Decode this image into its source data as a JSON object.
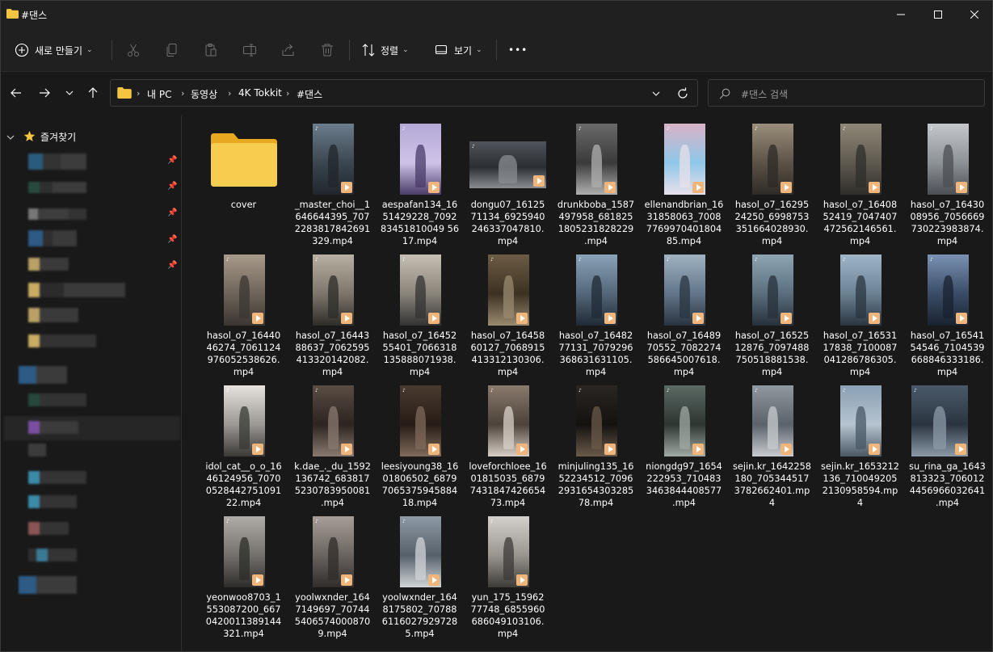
{
  "window": {
    "title": "#댄스"
  },
  "toolbar": {
    "new_label": "새로 만들기",
    "sort_label": "정렬",
    "view_label": "보기",
    "more_label": "•••"
  },
  "address": {
    "crumbs": [
      "내 PC",
      "동영상",
      "4K Tokkit",
      "#댄스"
    ]
  },
  "search": {
    "placeholder": "#댄스 검색"
  },
  "sidebar": {
    "favorites_label": "즐겨찾기"
  },
  "files": [
    {
      "name": "cover",
      "type": "folder"
    },
    {
      "name": "_master_choi__1\n646644395_707\n2283817842691\n329.mp4",
      "type": "video"
    },
    {
      "name": "aespafan134_16\n51429228_7092\n83451810049 56\n17.mp4",
      "type": "video"
    },
    {
      "name": "dongu07_16125\n71134_6925940\n246337047810.\nmp4",
      "type": "video"
    },
    {
      "name": "drunkboba_1587\n497958_681825\n1805231828229\n.mp4",
      "type": "video"
    },
    {
      "name": "ellenandbrian_16\n31858063_7008\n7769970401804\n85.mp4",
      "type": "video"
    },
    {
      "name": "hasol_o7_16295\n24250_6998753\n351664028930.\nmp4",
      "type": "video"
    },
    {
      "name": "hasol_o7_16408\n52419_7047407\n472562146561.\nmp4",
      "type": "video"
    },
    {
      "name": "hasol_o7_16430\n08956_7056669\n730223983874.\nmp4",
      "type": "video"
    },
    {
      "name": "hasol_o7_16440\n46274_7061124\n976052538626.\nmp4",
      "type": "video"
    },
    {
      "name": "hasol_o7_16443\n88637_7062595\n413320142082.\nmp4",
      "type": "video"
    },
    {
      "name": "hasol_o7_16452\n55401_7066318\n135888071938.\nmp4",
      "type": "video"
    },
    {
      "name": "hasol_o7_16458\n60127_7068915\n413312130306.\nmp4",
      "type": "video"
    },
    {
      "name": "hasol_o7_16482\n77131_7079296\n368631631105.\nmp4",
      "type": "video"
    },
    {
      "name": "hasol_o7_16489\n70552_7082274\n586645007618.\nmp4",
      "type": "video"
    },
    {
      "name": "hasol_o7_16525\n12876_7097488\n750518881538.\nmp4",
      "type": "video"
    },
    {
      "name": "hasol_o7_16531\n17838_7100087\n041286786305.\nmp4",
      "type": "video"
    },
    {
      "name": "hasol_o7_16541\n54546_7104539\n668846333186.\nmp4",
      "type": "video"
    },
    {
      "name": "idol_cat__o_o_16\n46124956_7070\n0528442751091\n22.mp4",
      "type": "video"
    },
    {
      "name": "k.dae_._du_1592\n136742_683817\n5230783950081\n.mp4",
      "type": "video"
    },
    {
      "name": "leesiyoung38_16\n01806502_6879\n7065375945884\n18.mp4",
      "type": "video"
    },
    {
      "name": "loveforchloee_16\n01815035_6879\n7431847426654\n73.mp4",
      "type": "video"
    },
    {
      "name": "minjuling135_16\n52234512_7096\n2931654303285\n78.mp4",
      "type": "video"
    },
    {
      "name": "niongdg97_1654\n222953_710483\n3463844408577\n.mp4",
      "type": "video"
    },
    {
      "name": "sejin.kr_1642258\n180_705344517\n3782662401.mp\n4",
      "type": "video"
    },
    {
      "name": "sejin.kr_1653212\n136_710049205\n2130958594.mp\n4",
      "type": "video"
    },
    {
      "name": "su_rina_ga_1643\n813323_706012\n4456966032641\n.mp4",
      "type": "video"
    },
    {
      "name": "yeonwoo8703_1\n553087200_667\n0420011389144\n321.mp4",
      "type": "video"
    },
    {
      "name": "yoolwxnder_164\n7149697_70744\n5406574000870\n9.mp4",
      "type": "video"
    },
    {
      "name": "yoolwxnder_164\n8175802_70788\n6116027929728\n5.mp4",
      "type": "video"
    },
    {
      "name": "yun_175_15962\n77748_6855960\n686049103106.\nmp4",
      "type": "video"
    }
  ],
  "colors": {
    "bg": "#191919",
    "chrome": "#202020",
    "folder": "#f5c542",
    "video_badge": "#f0b57a"
  }
}
